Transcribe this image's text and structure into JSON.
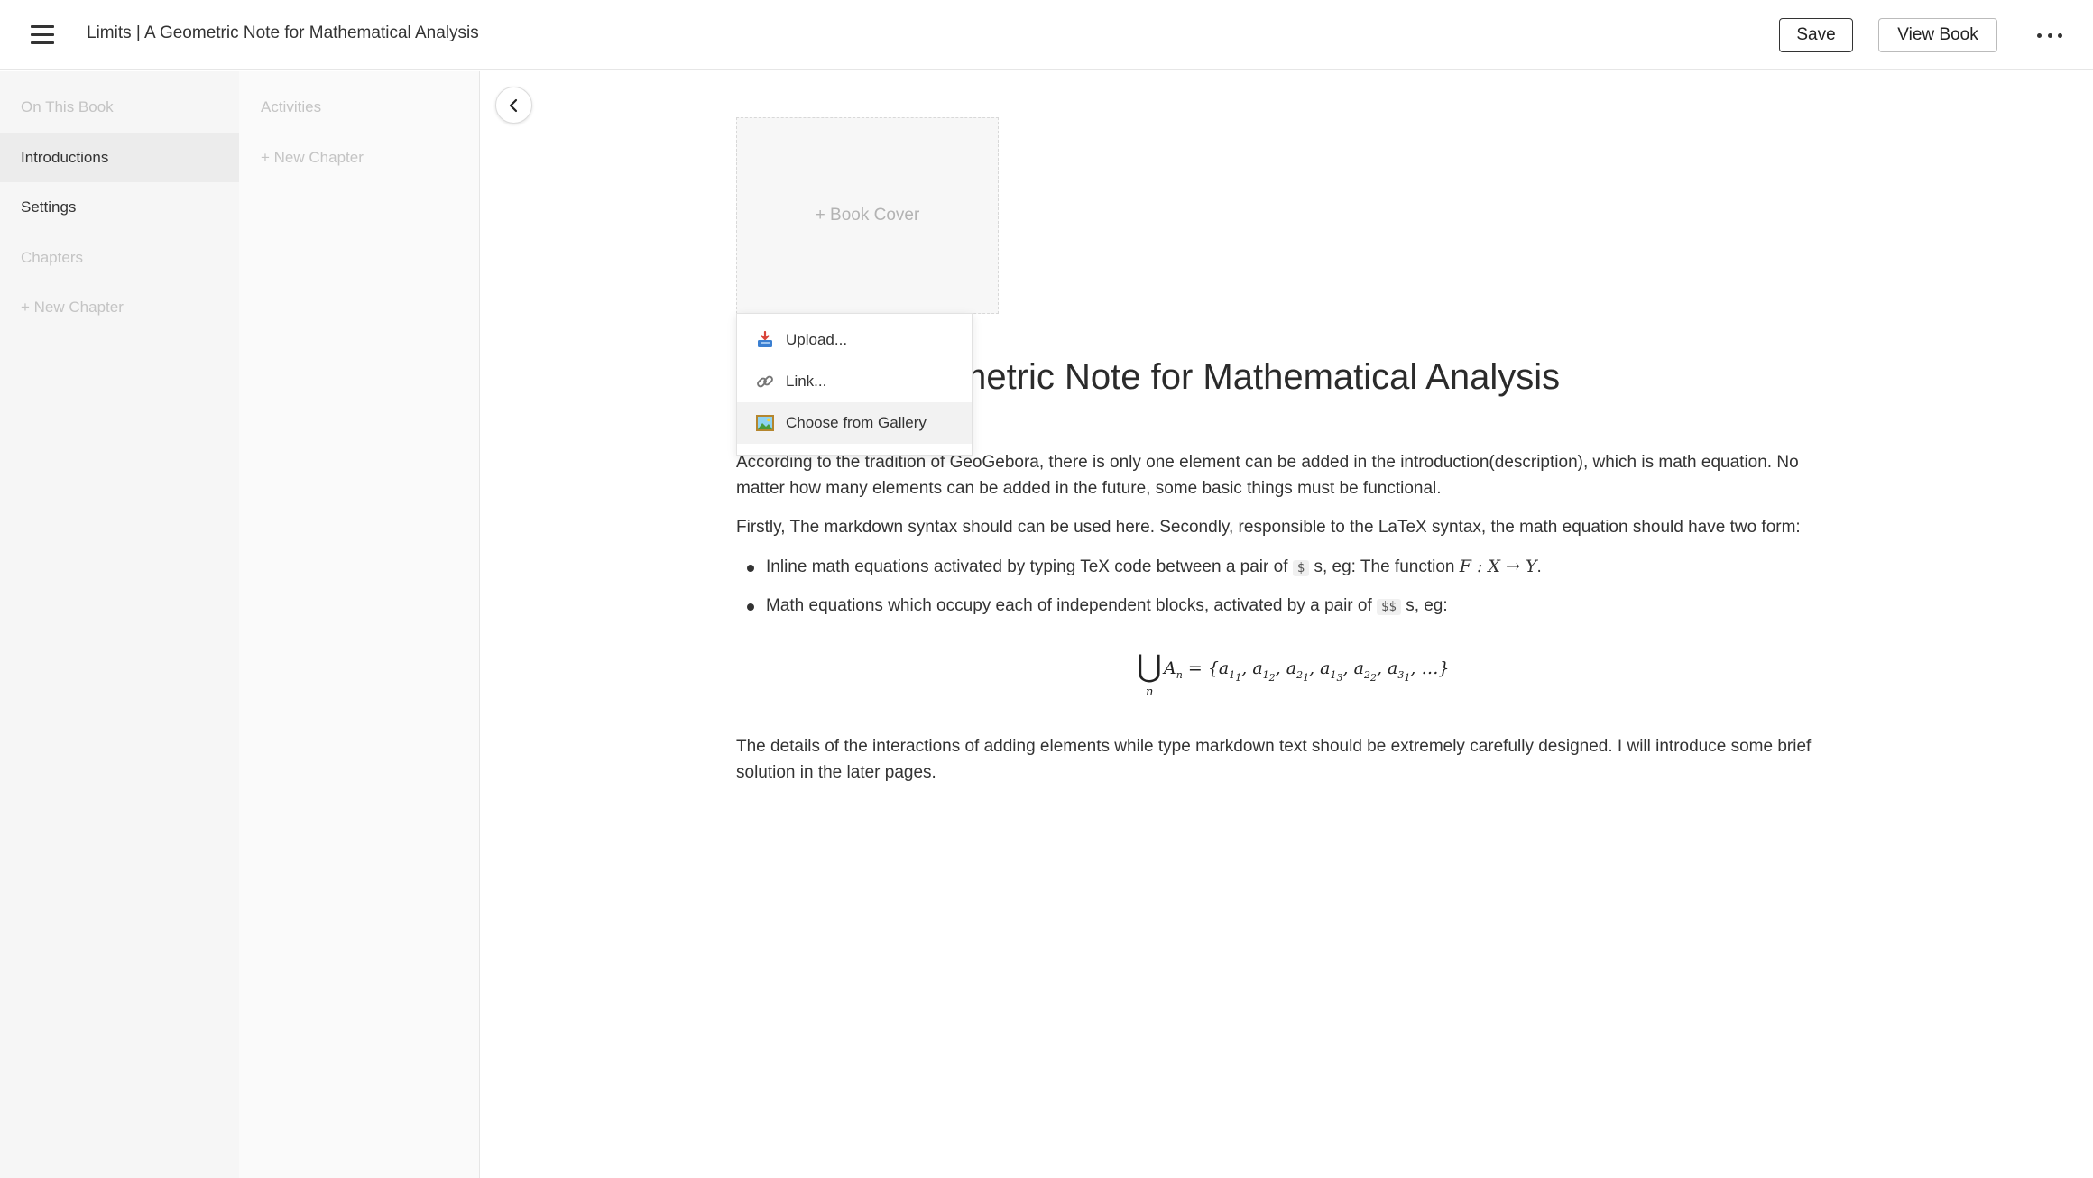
{
  "header": {
    "title": "Limits | A Geometric Note for Mathematical Analysis",
    "save_label": "Save",
    "view_book_label": "View Book"
  },
  "sidebar": {
    "items": [
      {
        "label": "On This Book"
      },
      {
        "label": "Introductions"
      },
      {
        "label": "Settings"
      },
      {
        "label": "Chapters"
      },
      {
        "label": "+ New Chapter"
      }
    ]
  },
  "subnav": {
    "items": [
      {
        "label": "Activities"
      },
      {
        "label": "+ New Chapter"
      }
    ]
  },
  "cover": {
    "label": "+ Book Cover"
  },
  "cover_menu": {
    "items": [
      {
        "label": "Upload...",
        "icon": "inbox-tray-icon"
      },
      {
        "label": "Link...",
        "icon": "link-icon"
      },
      {
        "label": "Choose from Gallery",
        "icon": "framed-picture-icon"
      }
    ]
  },
  "document": {
    "title_visible": "metric Note for Mathematical Analysis",
    "paragraph1": "According to the tradition of GeoGebora, there is only one element can be added in the introduction(description), which is math equation. No matter how many elements can be added in the future, some basic things must be functional.",
    "paragraph2": "Firstly, The markdown syntax should can be used here. Secondly, responsible to the LaTeX syntax, the math equation should have two form:",
    "bullet1_text": "Inline math equations activated by typing TeX code between a pair of",
    "bullet1_code": "$",
    "bullet1_after": "s, eg: The function",
    "bullet1_math": "F : X → Y",
    "bullet1_end": ".",
    "bullet2_text": "Math equations which occupy each of independent blocks, activated by a pair of",
    "bullet2_code": "$$",
    "bullet2_after": "s, eg:",
    "display_union": "⋃",
    "display_sub": "n",
    "paragraph3": "The details of the interactions of adding elements while type markdown text should be extremely carefully designed. I will introduce some brief solution in the later pages."
  },
  "colors": {
    "sidebar_bg": "#f6f6f6",
    "active_item_bg": "#ececec",
    "muted_text": "#c4c4c4"
  }
}
